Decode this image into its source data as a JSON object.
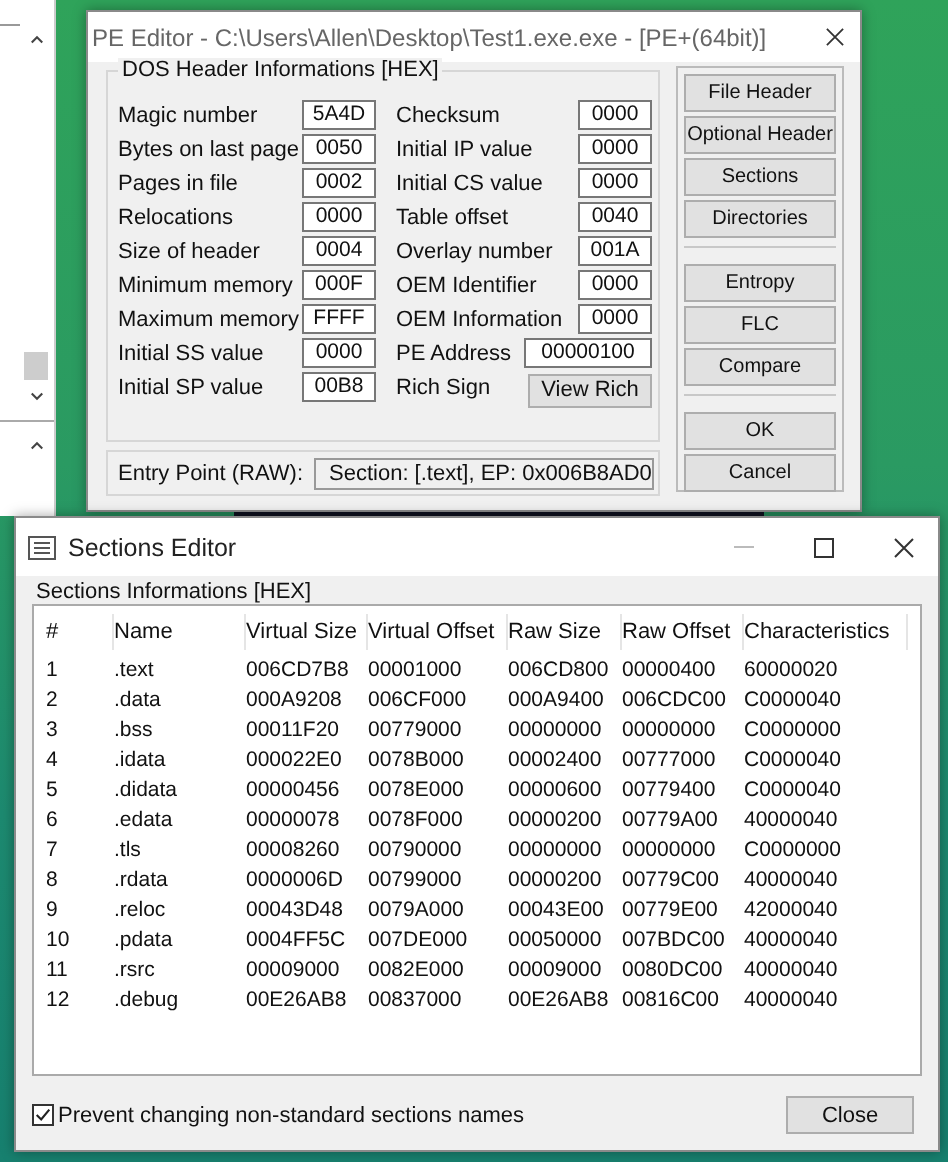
{
  "pe_editor": {
    "title": "PE Editor - C:\\Users\\Allen\\Desktop\\Test1.exe.exe - [PE+(64bit)]",
    "group_title": "DOS Header Informations [HEX]",
    "left_fields": [
      {
        "label": "Magic number",
        "value": "5A4D"
      },
      {
        "label": "Bytes on last page",
        "value": "0050"
      },
      {
        "label": "Pages in file",
        "value": "0002"
      },
      {
        "label": "Relocations",
        "value": "0000"
      },
      {
        "label": "Size of header",
        "value": "0004"
      },
      {
        "label": "Minimum memory",
        "value": "000F"
      },
      {
        "label": "Maximum memory",
        "value": "FFFF"
      },
      {
        "label": "Initial SS value",
        "value": "0000"
      },
      {
        "label": "Initial SP value",
        "value": "00B8"
      }
    ],
    "right_fields": [
      {
        "kind": "field",
        "label": "Checksum",
        "value": "0000"
      },
      {
        "kind": "field",
        "label": "Initial IP value",
        "value": "0000"
      },
      {
        "kind": "field",
        "label": "Initial CS value",
        "value": "0000"
      },
      {
        "kind": "field",
        "label": "Table offset",
        "value": "0040"
      },
      {
        "kind": "field",
        "label": "Overlay number",
        "value": "001A"
      },
      {
        "kind": "field",
        "label": "OEM Identifier",
        "value": "0000"
      },
      {
        "kind": "field",
        "label": "OEM Information",
        "value": "0000"
      },
      {
        "kind": "wide",
        "label": "PE Address",
        "value": "00000100"
      },
      {
        "kind": "button",
        "label": "Rich Sign",
        "value": "View Rich"
      }
    ],
    "entry_point": {
      "label": "Entry Point (RAW):",
      "value": "Section: [.text], EP: 0x006B8AD0"
    },
    "button_groups": [
      [
        "File Header",
        "Optional Header",
        "Sections",
        "Directories"
      ],
      [
        "Entropy",
        "FLC",
        "Compare"
      ],
      [
        "OK",
        "Cancel"
      ]
    ]
  },
  "sections_editor": {
    "title": "Sections Editor",
    "group_title": "Sections Informations [HEX]",
    "columns": [
      "#",
      "Name",
      "Virtual Size",
      "Virtual Offset",
      "Raw Size",
      "Raw Offset",
      "Characteristics"
    ],
    "rows": [
      [
        "1",
        ".text",
        "006CD7B8",
        "00001000",
        "006CD800",
        "00000400",
        "60000020"
      ],
      [
        "2",
        ".data",
        "000A9208",
        "006CF000",
        "000A9400",
        "006CDC00",
        "C0000040"
      ],
      [
        "3",
        ".bss",
        "00011F20",
        "00779000",
        "00000000",
        "00000000",
        "C0000000"
      ],
      [
        "4",
        ".idata",
        "000022E0",
        "0078B000",
        "00002400",
        "00777000",
        "C0000040"
      ],
      [
        "5",
        ".didata",
        "00000456",
        "0078E000",
        "00000600",
        "00779400",
        "C0000040"
      ],
      [
        "6",
        ".edata",
        "00000078",
        "0078F000",
        "00000200",
        "00779A00",
        "40000040"
      ],
      [
        "7",
        ".tls",
        "00008260",
        "00790000",
        "00000000",
        "00000000",
        "C0000000"
      ],
      [
        "8",
        ".rdata",
        "0000006D",
        "00799000",
        "00000200",
        "00779C00",
        "40000040"
      ],
      [
        "9",
        ".reloc",
        "00043D48",
        "0079A000",
        "00043E00",
        "00779E00",
        "42000040"
      ],
      [
        "10",
        ".pdata",
        "0004FF5C",
        "007DE000",
        "00050000",
        "007BDC00",
        "40000040"
      ],
      [
        "11",
        ".rsrc",
        "00009000",
        "0082E000",
        "00009000",
        "0080DC00",
        "40000040"
      ],
      [
        "12",
        ".debug",
        "00E26AB8",
        "00837000",
        "00E26AB8",
        "00816C00",
        "40000040"
      ]
    ],
    "prevent_checkbox": {
      "label": "Prevent changing non-standard sections names",
      "checked": true
    },
    "close_button": "Close"
  }
}
